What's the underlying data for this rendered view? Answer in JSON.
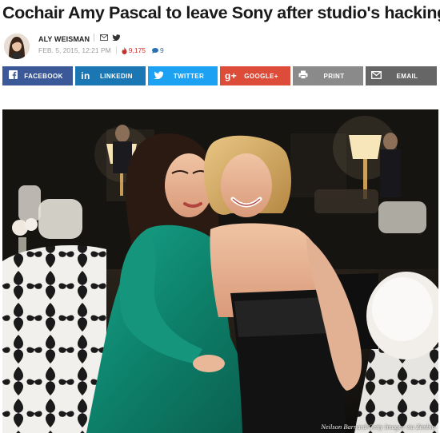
{
  "article": {
    "headline": "Cochair Amy Pascal to leave Sony after studio's hacking"
  },
  "byline": {
    "author": "ALY WEISMAN",
    "date": "FEB. 5, 2015, 12:21 PM",
    "views": "9,175",
    "comments": "9"
  },
  "share": {
    "facebook": "FACEBOOK",
    "linkedin": "LINKEDIN",
    "twitter": "TWITTER",
    "google": "GOOGLE+",
    "print": "PRINT",
    "email": "EMAIL",
    "google_glyph": "g+",
    "linkedin_glyph": "in"
  },
  "photo": {
    "credit": "Neilson Barnard/Getty Images via Zimbio"
  },
  "colors": {
    "facebook": "#3b5998",
    "linkedin": "#1b77b4",
    "twitter": "#1da1f2",
    "google": "#dd4b39",
    "print": "#8a8a8a",
    "email": "#666666",
    "views": "#c9302c",
    "comments": "#2a6fb0"
  }
}
